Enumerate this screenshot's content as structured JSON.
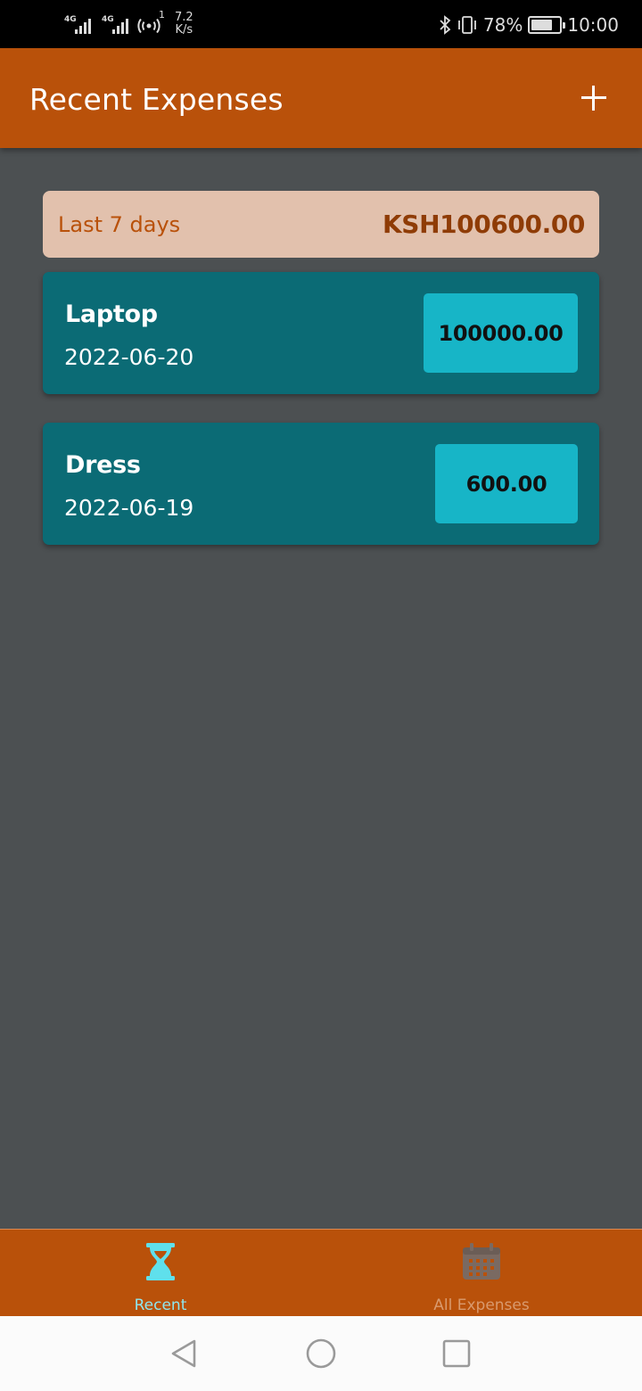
{
  "status_bar": {
    "network_1": "4G",
    "network_2": "4G",
    "hotspot_count": "1",
    "speed_value": "7.2",
    "speed_unit": "K/s",
    "battery": "78%",
    "battery_level": 0.78,
    "time": "10:00"
  },
  "app_bar": {
    "title": "Recent Expenses",
    "add_icon": "plus-icon"
  },
  "summary": {
    "label": "Last 7 days",
    "total": "KSH100600.00"
  },
  "expenses": [
    {
      "title": "Laptop",
      "date": "2022-06-20",
      "amount": "100000.00"
    },
    {
      "title": "Dress",
      "date": "2022-06-19",
      "amount": "600.00"
    }
  ],
  "bottom_nav": {
    "items": [
      {
        "label": "Recent",
        "icon": "hourglass-icon",
        "active": true
      },
      {
        "label": "All Expenses",
        "icon": "calendar-icon",
        "active": false
      }
    ]
  },
  "colors": {
    "primary": "#b9510a",
    "card": "#0b6b75",
    "amount_chip": "#17b5c7",
    "background": "#4c5052",
    "summary_bg": "#e2c1ad",
    "active_nav": "#8fe6ee"
  }
}
